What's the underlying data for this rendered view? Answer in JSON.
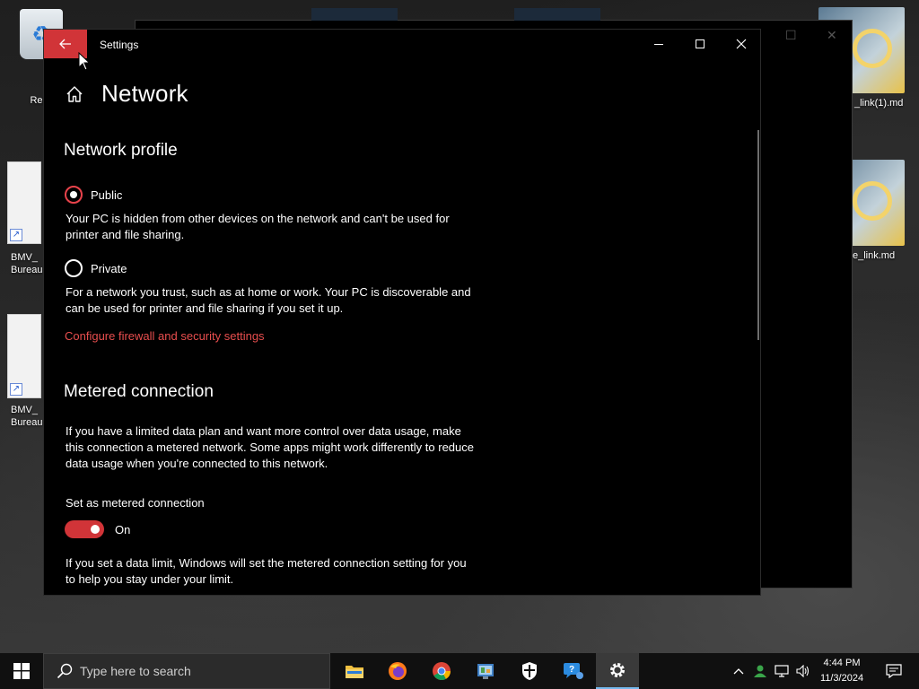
{
  "desktop": {
    "icons": [
      {
        "label": "Recy"
      },
      {
        "label": "BMV_\nBureau"
      },
      {
        "label": "BMV_\nBureau"
      },
      {
        "label": "_link(1).md"
      },
      {
        "label": "e_link.md"
      }
    ]
  },
  "window": {
    "title": "Settings",
    "back_icon": "back-arrow-icon",
    "controls": [
      "minimize-icon",
      "maximize-icon",
      "close-icon"
    ]
  },
  "page": {
    "title": "Network",
    "home_icon": "home-icon"
  },
  "network_profile": {
    "heading": "Network profile",
    "options": [
      {
        "label": "Public",
        "checked": true,
        "description": "Your PC is hidden from other devices on the network and can't be used for printer and file sharing."
      },
      {
        "label": "Private",
        "checked": false,
        "description": "For a network you trust, such as at home or work. Your PC is discoverable and can be used for printer and file sharing if you set it up."
      }
    ],
    "link": "Configure firewall and security settings"
  },
  "metered": {
    "heading": "Metered connection",
    "description": "If you have a limited data plan and want more control over data usage, make this connection a metered network. Some apps might work differently to reduce data usage when you're connected to this network.",
    "toggle_label": "Set as metered connection",
    "toggle_state": "On",
    "data_limit_text": "If you set a data limit, Windows will set the metered connection setting for you to help you stay under your limit."
  },
  "taskbar": {
    "search_placeholder": "Type here to search",
    "apps": [
      "file-explorer-icon",
      "firefox-icon",
      "chrome-icon",
      "control-panel-icon",
      "windows-security-icon",
      "get-help-icon",
      "settings-icon"
    ],
    "clock_time": "4:44 PM",
    "clock_date": "11/3/2024"
  },
  "colors": {
    "accent": "#d13438",
    "link": "#e84e4e",
    "window_bg": "#000000",
    "taskbar_bg": "#101010"
  }
}
